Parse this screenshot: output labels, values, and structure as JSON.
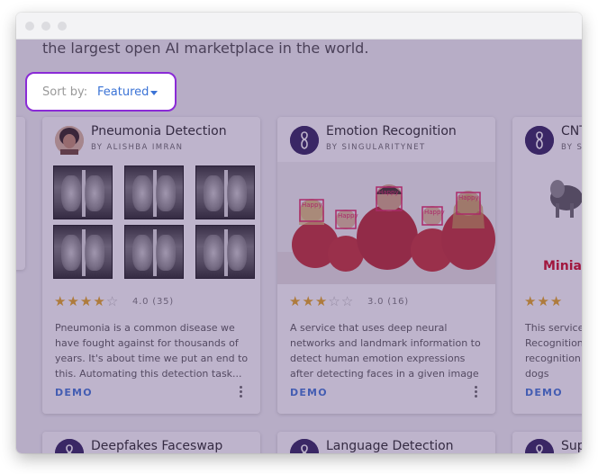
{
  "tagline": "the largest open AI marketplace in the world.",
  "sort": {
    "label": "Sort by:",
    "value": "Featured"
  },
  "cards": [
    {
      "title": "Pneumonia Detection",
      "author": "BY ALISHBA IMRAN",
      "rating_text": "4.0 (35)",
      "stars": 4,
      "description": "Pneumonia is a common disease we have fought against for thousands of years. It's about time we put an end to this. Automating this detection task...",
      "demo": "DEMO"
    },
    {
      "title": "Emotion Recognition",
      "author": "BY SINGULARITYNET",
      "rating_text": "3.0 (16)",
      "stars": 3,
      "description": "A service that uses deep neural networks and landmark information to detect human emotion expressions after detecting faces in a given image",
      "demo": "DEMO",
      "face_labels": [
        "Happy",
        "Happy",
        "Happy",
        "Happy",
        "Happy"
      ]
    },
    {
      "title": "CNT",
      "author": "BY S",
      "image_caption": "Minia",
      "stars": 3,
      "description_lines": [
        "This service",
        "Recognition",
        "recognition",
        "dogs"
      ],
      "demo": "DEMO"
    }
  ],
  "bottom_cards": [
    {
      "title": "Deepfakes Faceswap"
    },
    {
      "title": "Language Detection"
    },
    {
      "title": "Sup"
    }
  ],
  "colors": {
    "accent": "#3b73d6",
    "highlight_border": "#8a2bd6",
    "star": "#e6a317",
    "caption_red": "#d0021b"
  }
}
